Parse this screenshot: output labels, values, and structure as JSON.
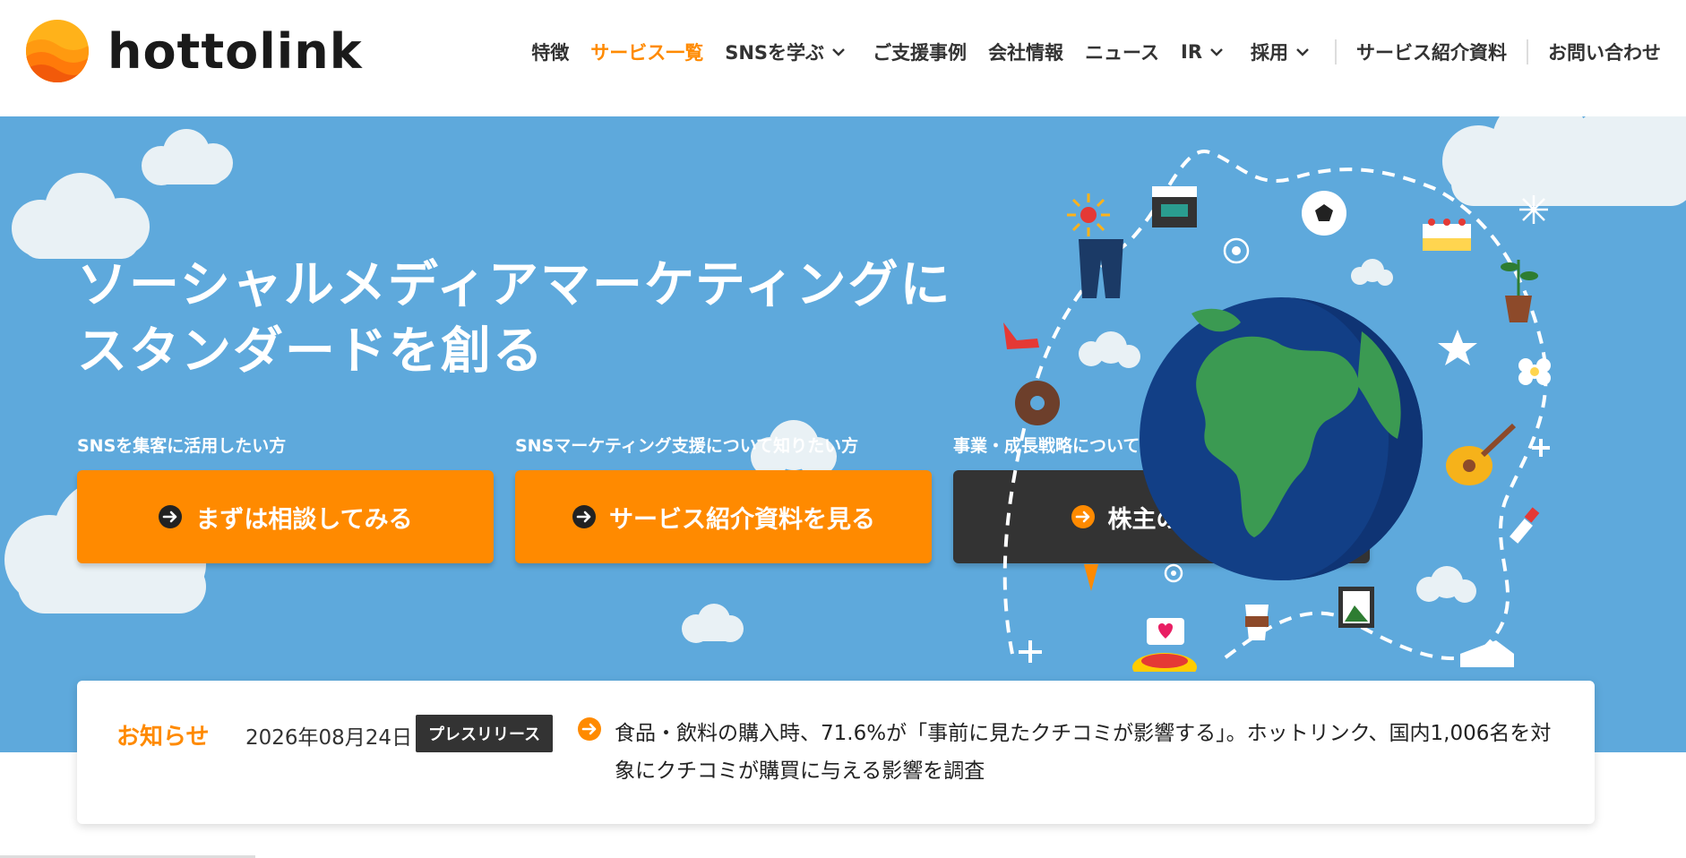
{
  "brand": {
    "name": "hottolink"
  },
  "nav": {
    "items": [
      {
        "label": "特徴"
      },
      {
        "label": "サービス一覧",
        "active": true
      },
      {
        "label": "SNSを学ぶ",
        "dropdown": true
      },
      {
        "label": "ご支援事例"
      },
      {
        "label": "会社情報"
      },
      {
        "label": "ニュース"
      },
      {
        "label": "IR",
        "dropdown": true
      },
      {
        "label": "採用",
        "dropdown": true
      }
    ],
    "secondary": [
      {
        "label": "サービス紹介資料"
      },
      {
        "label": "お問い合わせ"
      }
    ]
  },
  "hero": {
    "title_line1": "ソーシャルメディアマーケティングに",
    "title_line2": "スタンダードを創る",
    "ctas": [
      {
        "caption": "SNSを集客に活用したい方",
        "label": "まずは相談してみる",
        "style": "orange"
      },
      {
        "caption": "SNSマーケティング支援について知りたい方",
        "label": "サービス紹介資料を見る",
        "style": "orange"
      },
      {
        "caption": "事業・成長戦略について",
        "label": "株主の皆様へ",
        "style": "dark"
      }
    ]
  },
  "news": {
    "label": "お知らせ",
    "date": "2026年08月24日",
    "tag": "プレスリリース",
    "text": "食品・飲料の購入時、71.6%が「事前に見たクチコミが影響する」。ホットリンク、国内1,006名を対象にクチコミが購買に与える影響を調査"
  },
  "colors": {
    "accent": "#ff8a00",
    "hero_bg": "#5ea9dc",
    "dark_button": "#333333"
  }
}
